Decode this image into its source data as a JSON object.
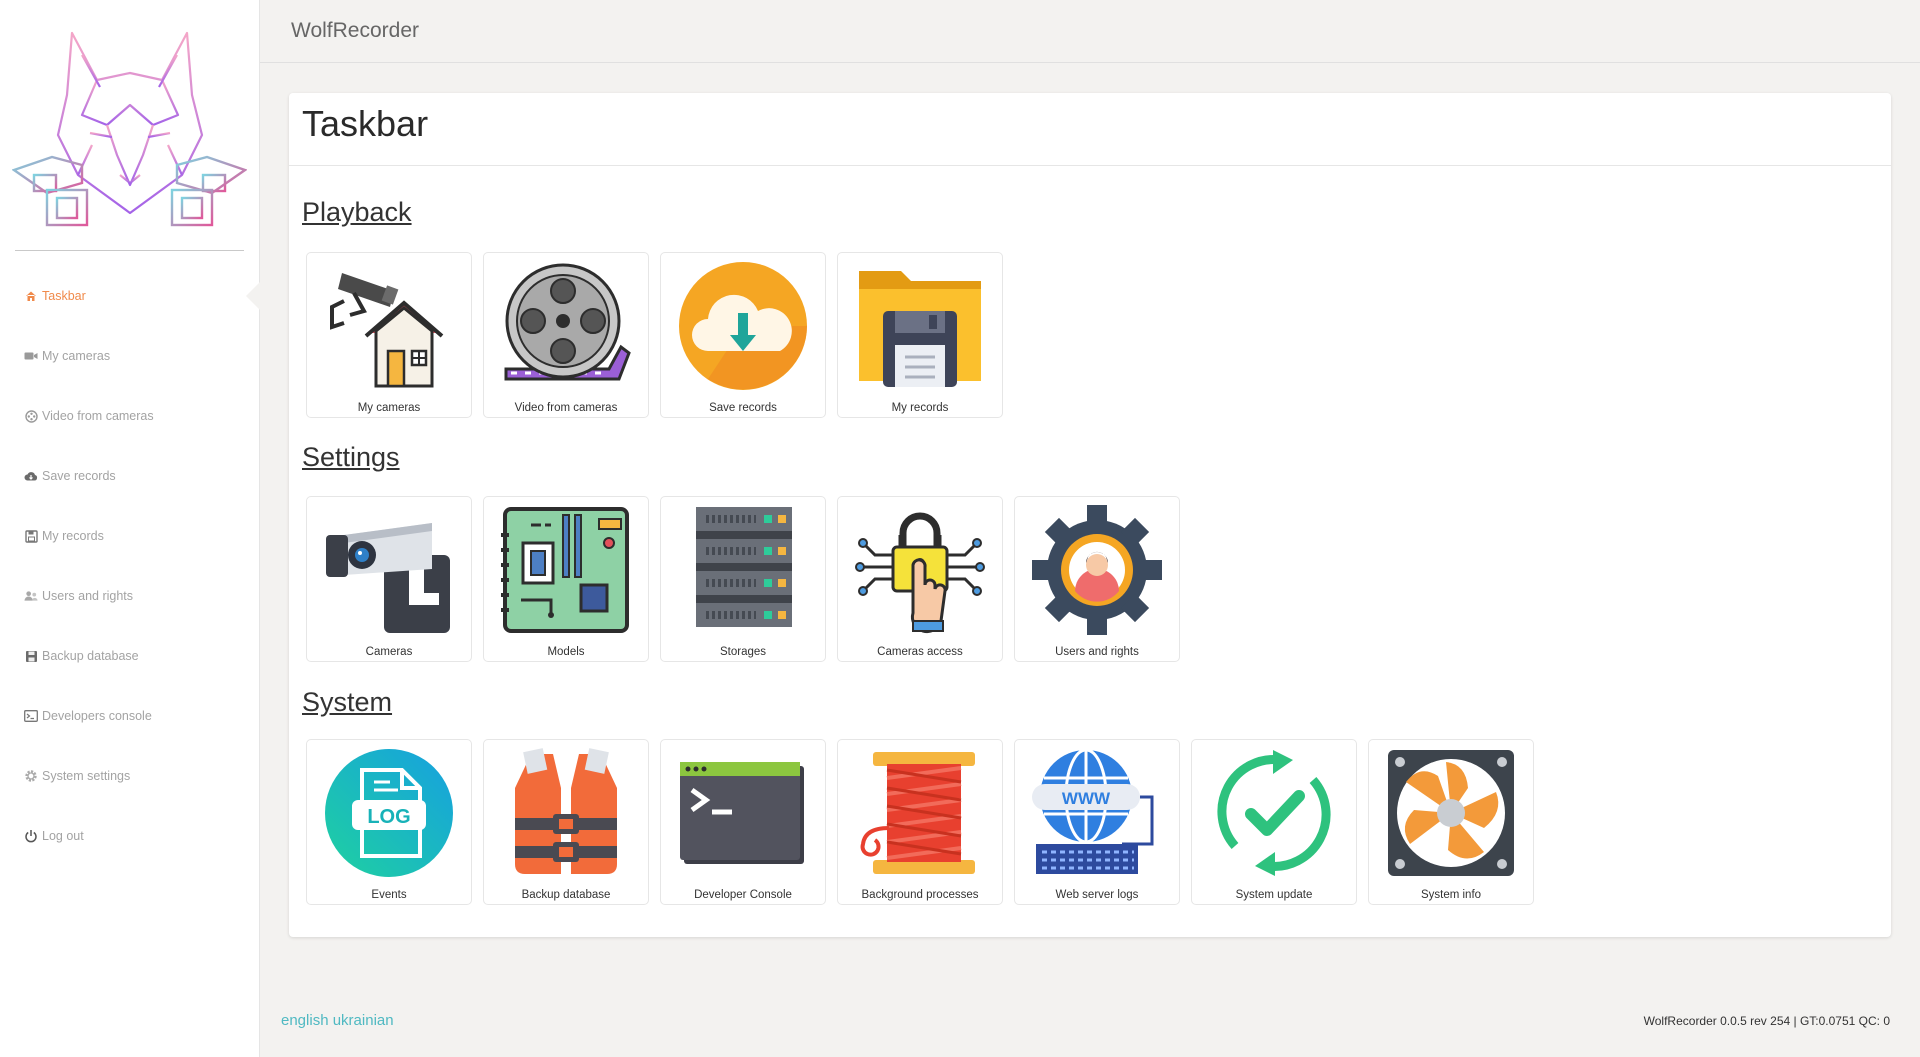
{
  "app": {
    "title": "WolfRecorder"
  },
  "sidebar": {
    "items": [
      {
        "label": "Taskbar",
        "icon": "home-icon",
        "active": true
      },
      {
        "label": "My cameras",
        "icon": "video-camera-icon"
      },
      {
        "label": "Video from cameras",
        "icon": "film-reel-icon"
      },
      {
        "label": "Save records",
        "icon": "cloud-download-icon"
      },
      {
        "label": "My records",
        "icon": "floppy-disk-icon"
      },
      {
        "label": "Users and rights",
        "icon": "users-icon"
      },
      {
        "label": "Backup database",
        "icon": "save-icon"
      },
      {
        "label": "Developers console",
        "icon": "terminal-icon"
      },
      {
        "label": "System settings",
        "icon": "gear-icon"
      },
      {
        "label": "Log out",
        "icon": "power-icon"
      }
    ]
  },
  "main": {
    "title": "Taskbar",
    "sections": [
      {
        "title": "Playback",
        "tiles": [
          {
            "label": "My cameras",
            "icon": "cctv-house-icon"
          },
          {
            "label": "Video from cameras",
            "icon": "film-reel-icon"
          },
          {
            "label": "Save records",
            "icon": "cloud-download-icon"
          },
          {
            "label": "My records",
            "icon": "folder-floppy-icon"
          }
        ]
      },
      {
        "title": "Settings",
        "tiles": [
          {
            "label": "Cameras",
            "icon": "security-camera-icon"
          },
          {
            "label": "Models",
            "icon": "motherboard-icon"
          },
          {
            "label": "Storages",
            "icon": "server-rack-icon"
          },
          {
            "label": "Cameras access",
            "icon": "padlock-touch-icon"
          },
          {
            "label": "Users and rights",
            "icon": "user-gear-icon"
          }
        ]
      },
      {
        "title": "System",
        "tiles": [
          {
            "label": "Events",
            "icon": "log-file-icon"
          },
          {
            "label": "Backup database",
            "icon": "life-vest-icon"
          },
          {
            "label": "Developer Console",
            "icon": "console-window-icon"
          },
          {
            "label": "Background processes",
            "icon": "thread-spool-icon"
          },
          {
            "label": "Web server logs",
            "icon": "www-globe-icon"
          },
          {
            "label": "System update",
            "icon": "update-check-icon"
          },
          {
            "label": "System info",
            "icon": "cooling-fan-icon"
          }
        ]
      }
    ]
  },
  "footer": {
    "languages": [
      "english",
      "ukrainian"
    ],
    "version": "WolfRecorder 0.0.5 rev 254 | GT:0.0751 QC: 0"
  },
  "colors": {
    "accent": "#f08a4b",
    "link": "#4fb9c2",
    "background": "#f3f2f0"
  }
}
